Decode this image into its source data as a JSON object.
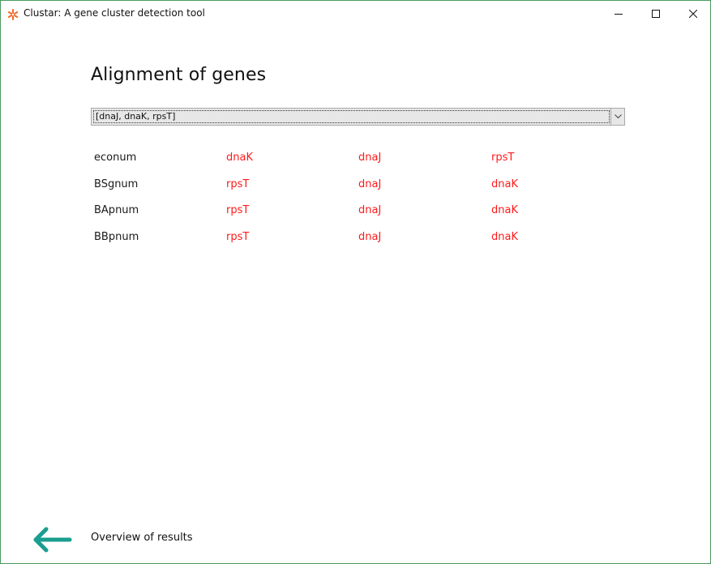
{
  "window": {
    "title": "Clustar: A gene cluster detection tool",
    "icon": "asterisk-logo-icon",
    "controls": [
      "minimize-icon",
      "maximize-icon",
      "close-icon"
    ]
  },
  "page": {
    "heading": "Alignment of genes"
  },
  "cluster_select": {
    "value": "[dnaJ, dnaK, rpsT]"
  },
  "alignment": {
    "rows": [
      {
        "organism": "econum",
        "genes": [
          "dnaK",
          "dnaJ",
          "rpsT"
        ]
      },
      {
        "organism": "BSgnum",
        "genes": [
          "rpsT",
          "dnaJ",
          "dnaK"
        ]
      },
      {
        "organism": "BApnum",
        "genes": [
          "rpsT",
          "dnaJ",
          "dnaK"
        ]
      },
      {
        "organism": "BBpnum",
        "genes": [
          "rpsT",
          "dnaJ",
          "dnaK"
        ]
      }
    ]
  },
  "footer": {
    "back_label": "Overview of results",
    "back_icon": "arrow-left-icon"
  },
  "colors": {
    "gene_text": "#ff1a1a",
    "accent_arrow": "#1a9e8f",
    "window_border": "#4a9a5e",
    "logo": "#f26b2a"
  }
}
